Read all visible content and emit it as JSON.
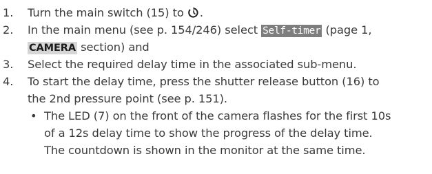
{
  "steps": [
    {
      "number": "1.",
      "before": "Turn the main switch (15) to ",
      "icon": "self-timer-icon",
      "after": "."
    },
    {
      "number": "2.",
      "before": "In the main menu (see p. 154/246) select ",
      "menu_item": "Self-timer",
      "middle": " (page 1,",
      "section": "CAMERA",
      "after": " section) and"
    },
    {
      "number": "3.",
      "text": "Select the required delay time in the associated sub-menu."
    },
    {
      "number": "4.",
      "line1": "To start the delay time, press the shutter release button (16) to",
      "line2": "the 2nd pressure point (see p. 151).",
      "bullet_symbol": "•",
      "bullet_line1": "The LED (7) on the front of the camera flashes for the first 10s",
      "bullet_line2": "of a 12s delay time to show the progress of the delay time.",
      "bullet_line3": "The countdown is shown in the monitor at the same time."
    }
  ],
  "colors": {
    "text": "#3a3a3a",
    "menu_tag_bg": "#7e7e7e",
    "section_tag_bg": "#d6d6d6"
  }
}
